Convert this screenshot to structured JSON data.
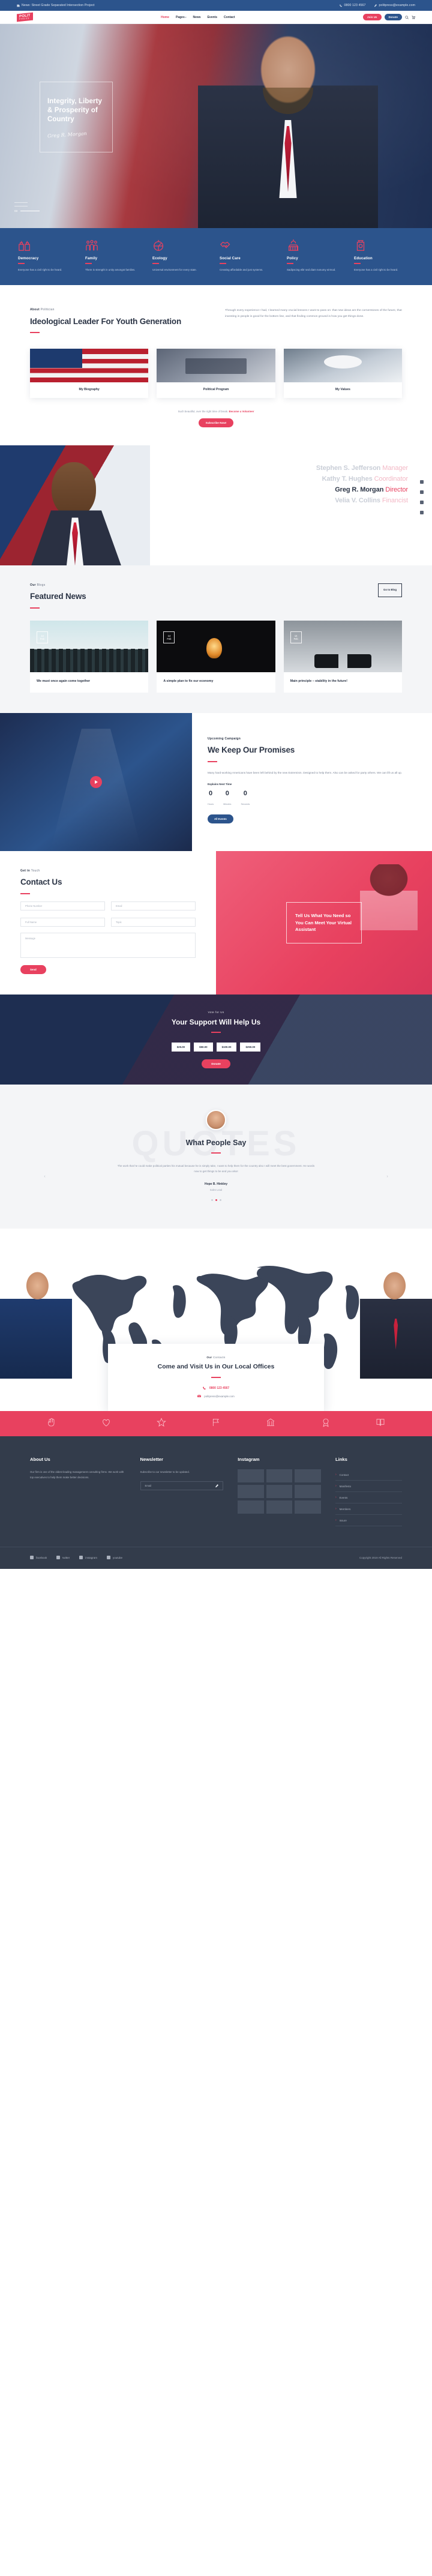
{
  "topbar": {
    "news_icon": "newspaper-icon",
    "news": "News: Street Grade Separated Intersection Project",
    "phone_icon": "phone-icon",
    "phone": "0800 123 4567",
    "mail_icon": "pencil-icon",
    "email": "politpress@example.com"
  },
  "brand": {
    "name": "POLIT",
    "sub": "PRESS"
  },
  "nav": {
    "items": [
      {
        "label": "Home",
        "active": true,
        "caret": ""
      },
      {
        "label": "Pages",
        "active": false,
        "caret": "▾"
      },
      {
        "label": "News",
        "active": false,
        "caret": ""
      },
      {
        "label": "Events",
        "active": false,
        "caret": ""
      },
      {
        "label": "Contact",
        "active": false,
        "caret": ""
      }
    ],
    "join_label": "Join Us",
    "donate_label": "Donate",
    "search_icon": "search-icon",
    "cart_icon": "cart-icon"
  },
  "hero": {
    "title": "Integrity, Liberty & Prosperity of Country",
    "signature": "Greg R. Morgan",
    "slides": [
      "01",
      "02",
      "03"
    ],
    "active_slide": "03"
  },
  "features": [
    {
      "icon": "ballot-box-icon",
      "title": "Democracy",
      "desc": "Everyone has a civil right to be heard."
    },
    {
      "icon": "family-icon",
      "title": "Family",
      "desc": "There is strength in unity amongst families."
    },
    {
      "icon": "ecology-icon",
      "title": "Ecology",
      "desc": "Universal environment for every state."
    },
    {
      "icon": "handshake-icon",
      "title": "Social Care",
      "desc": "Creating affordable and just systems."
    },
    {
      "icon": "capitol-icon",
      "title": "Policy",
      "desc": "Sadipscing elitr sed diam nonumy eirmod."
    },
    {
      "icon": "lamp-icon",
      "title": "Education",
      "desc": "Everyone has a civil right to be heard."
    }
  ],
  "about": {
    "eyebrow_strong": "About",
    "eyebrow_light": "Politician",
    "title": "Ideological Leader For Youth Generation",
    "paragraph": "Through every experience I had, I learned many crucial lessons I want to pass on: that new ideas are the cornerstones of the future, that investing in people is good for the bottom line, and that finding common ground is how you get things done.",
    "cards": [
      {
        "image": "flag-photo",
        "caption": "My Biography"
      },
      {
        "image": "desk-photo",
        "caption": "Political Program"
      },
      {
        "image": "eagle-photo",
        "caption": "My Values"
      }
    ],
    "foot_text": "Such beautiful, over the right time of break.",
    "foot_link": "Become a Volunteer",
    "subscribe_label": "Subscribe Now!"
  },
  "team": {
    "members": [
      {
        "name": "Stephen S. Jefferson",
        "role": "Manager",
        "active": false
      },
      {
        "name": "Kathy T. Hughes",
        "role": "Coordinator",
        "active": false
      },
      {
        "name": "Greg R. Morgan",
        "role": "Director",
        "active": true
      },
      {
        "name": "Velia V. Collins",
        "role": "Financist",
        "active": false
      }
    ],
    "socials": [
      "facebook-icon",
      "twitter-icon",
      "instagram-icon",
      "youtube-icon"
    ]
  },
  "news": {
    "eyebrow_strong": "Our",
    "eyebrow_light": "Blogs",
    "title": "Featured News",
    "goto_label": "Go to Blog",
    "cards": [
      {
        "image": "crowd-photo",
        "day": "14",
        "month": "Feb",
        "title": "We must once again come together"
      },
      {
        "image": "bulb-photo",
        "day": "14",
        "month": "Feb",
        "title": "A simple plan to fix our economy"
      },
      {
        "image": "shoes-photo",
        "day": "14",
        "month": "Feb",
        "title": "Main principle – stability in the future!"
      }
    ]
  },
  "promises": {
    "play_icon": "play-icon",
    "eyebrow": "Upcoming Campaign",
    "title": "We Keep Our Promises",
    "paragraph": "Many hard-working Americans have been left behind by the new Extremism. Designed to help them. Also can be asked for party others. We can lift us all up.",
    "next_label": "Explains Next Time",
    "counters": [
      {
        "value": "0",
        "label": "Hours"
      },
      {
        "value": "0",
        "label": "Minutes"
      },
      {
        "value": "0",
        "label": "Seconds"
      }
    ],
    "button_label": "All Events"
  },
  "contact": {
    "eyebrow_strong": "Get in",
    "eyebrow_light": "Touch",
    "title": "Contact Us",
    "fields": [
      {
        "placeholder": "Phone Number"
      },
      {
        "placeholder": "Email"
      },
      {
        "placeholder": "Full Name"
      },
      {
        "placeholder": "Topic"
      }
    ],
    "message_placeholder": "Message",
    "send_label": "Send",
    "promo_title": "Tell Us What You Need so You Can Meet Your Virtual Assistant"
  },
  "support": {
    "eyebrow": "Vote for Us",
    "title": "Your Support Will Help Us",
    "amounts": [
      {
        "label": "$25.00",
        "active": false
      },
      {
        "label": "$50.00",
        "active": false
      },
      {
        "label": "$100.00",
        "active": false
      },
      {
        "label": "$250.00",
        "active": false
      }
    ],
    "donate_label": "Donate"
  },
  "testimonial": {
    "ghost_word": "QUOTES",
    "avatar": "avatar",
    "title": "What People Say",
    "quote": "The work that he could make political parties his mutual because he is simply take, I want to help them for the country also I will meet the best government. He words now to get things to be and you also!",
    "author": "Hope B. Hinkley",
    "role": "Sales Lead",
    "dots": 3,
    "active_dot": 1,
    "prev_icon": "chevron-left-icon",
    "next_icon": "chevron-right-icon"
  },
  "offices": {
    "eyebrow_strong": "Our",
    "eyebrow_light": "Contacts",
    "title": "Come and Visit Us in Our Local Offices",
    "phone_icon": "phone-icon",
    "phone": "0800 123 4567",
    "mail_icon": "mail-icon",
    "email": "politpress@example.com"
  },
  "icon_strip": [
    "hand-icon",
    "heart-icon",
    "star-icon",
    "flag-icon",
    "bank-icon",
    "badge-icon",
    "book-icon"
  ],
  "footer": {
    "about": {
      "title": "About Us",
      "text": "Our firm is one of the oldest leading management consulting firms. We work with top executives to help them make better decisions."
    },
    "newsletter": {
      "title": "Newsletter",
      "text": "Subscribe to our newsletter to be updated.",
      "placeholder": "Email",
      "submit_icon": "pencil-icon"
    },
    "instagram": {
      "title": "Instagram",
      "tiles": 9
    },
    "links": {
      "title": "Links",
      "items": [
        "Contact",
        "Manifesto",
        "Events",
        "Members",
        "Issure"
      ]
    },
    "socials": [
      {
        "icon": "facebook-icon",
        "label": "facebook"
      },
      {
        "icon": "twitter-icon",
        "label": "twitter"
      },
      {
        "icon": "instagram-icon",
        "label": "instagram"
      },
      {
        "icon": "youtube-icon",
        "label": "youtube"
      }
    ],
    "copyright": "Copyright 2019 All Rights Reserved"
  },
  "colors": {
    "primary_blue": "#2c548c",
    "accent_red": "#e8415f",
    "dark": "#2b3445",
    "footer": "#333c4b"
  }
}
